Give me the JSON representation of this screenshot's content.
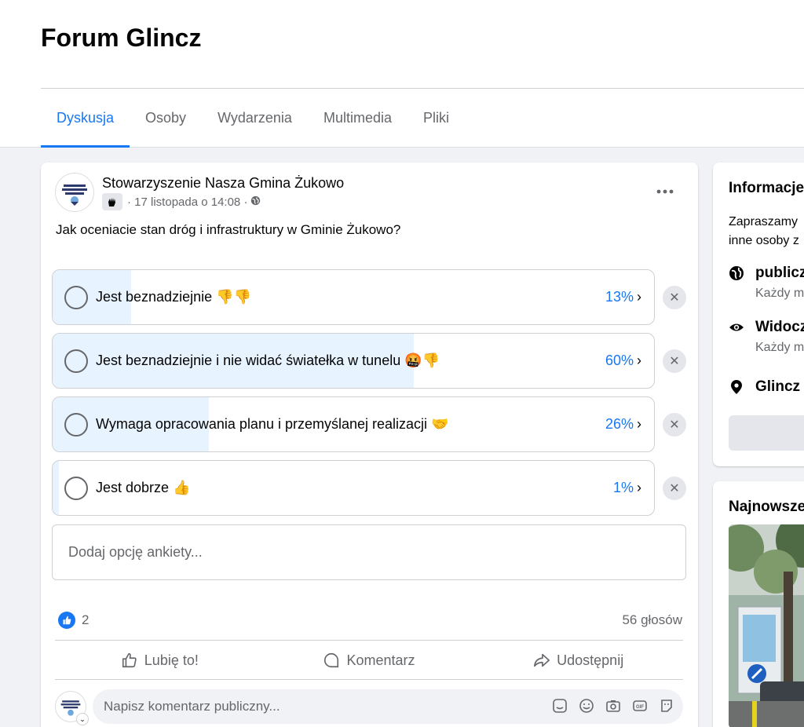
{
  "group": {
    "title": "Forum Glincz"
  },
  "tabs": [
    {
      "label": "Dyskusja",
      "active": true
    },
    {
      "label": "Osoby"
    },
    {
      "label": "Wydarzenia"
    },
    {
      "label": "Multimedia"
    },
    {
      "label": "Pliki"
    }
  ],
  "post": {
    "author": "Stowarzyszenie Nasza Gmina Żukowo",
    "meta": "· 17 listopada o 14:08 ·",
    "question": "Jak oceniacie stan dróg i infrastruktury w Gminie Żukowo?",
    "poll_options": [
      {
        "label": "Jest beznadziejnie 👎👎",
        "percent_text": "13%",
        "percent": 13
      },
      {
        "label": "Jest beznadziejnie i nie widać światełka w tunelu 🤬👎",
        "percent_text": "60%",
        "percent": 60
      },
      {
        "label": "Wymaga opracowania planu i przemyślanej realizacji 🤝",
        "percent_text": "26%",
        "percent": 26
      },
      {
        "label": "Jest dobrze 👍",
        "percent_text": "1%",
        "percent": 1
      }
    ],
    "add_option_placeholder": "Dodaj opcję ankiety...",
    "reactions_count": "2",
    "votes": "56 głosów",
    "actions": {
      "like": "Lubię to!",
      "comment": "Komentarz",
      "share": "Udostępnij"
    },
    "comment_placeholder": "Napisz komentarz publiczny..."
  },
  "sidebar": {
    "info": {
      "title": "Informacje",
      "description_lines": [
        "Zapraszamy",
        "inne osoby z"
      ],
      "items": [
        {
          "icon": "globe-icon",
          "main": "publiczna",
          "sub": "Każdy może"
        },
        {
          "icon": "eye-icon",
          "main": "Widoczna",
          "sub": "Każdy może"
        },
        {
          "icon": "location-pin-icon",
          "main": "Glincz",
          "sub": ""
        }
      ]
    },
    "recent": {
      "title": "Najnowsze"
    }
  },
  "colors": {
    "accent": "#1877f2",
    "poll_fill": "#e7f3ff",
    "background": "#f0f2f5",
    "secondary_text": "#65676b"
  }
}
